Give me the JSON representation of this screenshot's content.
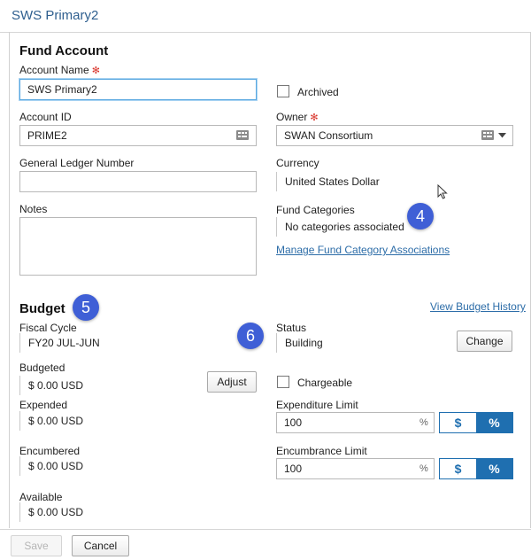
{
  "window": {
    "title": "SWS Primary2"
  },
  "fund_account": {
    "heading": "Fund Account",
    "account_name": {
      "label": "Account Name",
      "value": "SWS Primary2"
    },
    "archived": {
      "label": "Archived",
      "checked": false
    },
    "account_id": {
      "label": "Account ID",
      "value": "PRIME2"
    },
    "owner": {
      "label": "Owner",
      "value": "SWAN Consortium"
    },
    "gl_number": {
      "label": "General Ledger Number",
      "value": ""
    },
    "currency": {
      "label": "Currency",
      "value": "United States Dollar"
    },
    "notes": {
      "label": "Notes",
      "value": ""
    },
    "fund_categories": {
      "label": "Fund Categories",
      "value": "No categories associated",
      "manage_link": "Manage Fund Category Associations"
    }
  },
  "budget": {
    "heading": "Budget",
    "history_link": "View Budget History",
    "fiscal_cycle": {
      "label": "Fiscal Cycle",
      "value": "FY20 JUL-JUN"
    },
    "status": {
      "label": "Status",
      "value": "Building",
      "change_label": "Change"
    },
    "budgeted": {
      "label": "Budgeted",
      "value": "$ 0.00 USD",
      "adjust_label": "Adjust"
    },
    "chargeable": {
      "label": "Chargeable",
      "checked": false
    },
    "expended": {
      "label": "Expended",
      "value": "$ 0.00 USD"
    },
    "expenditure_limit": {
      "label": "Expenditure Limit",
      "value": "100",
      "unit": "%",
      "dollar": "$",
      "percent": "%"
    },
    "encumbered": {
      "label": "Encumbered",
      "value": "$ 0.00 USD"
    },
    "encumbrance_limit": {
      "label": "Encumbrance Limit",
      "value": "100",
      "unit": "%",
      "dollar": "$",
      "percent": "%"
    },
    "available": {
      "label": "Available",
      "value": "$ 0.00 USD"
    }
  },
  "callouts": {
    "four": "4",
    "five": "5",
    "six": "6"
  },
  "footer": {
    "save_label": "Save",
    "cancel_label": "Cancel"
  },
  "colors": {
    "accent": "#1f6fb0",
    "link": "#2d6da8",
    "required": "#d9342b",
    "callout": "#3f5fd6"
  }
}
